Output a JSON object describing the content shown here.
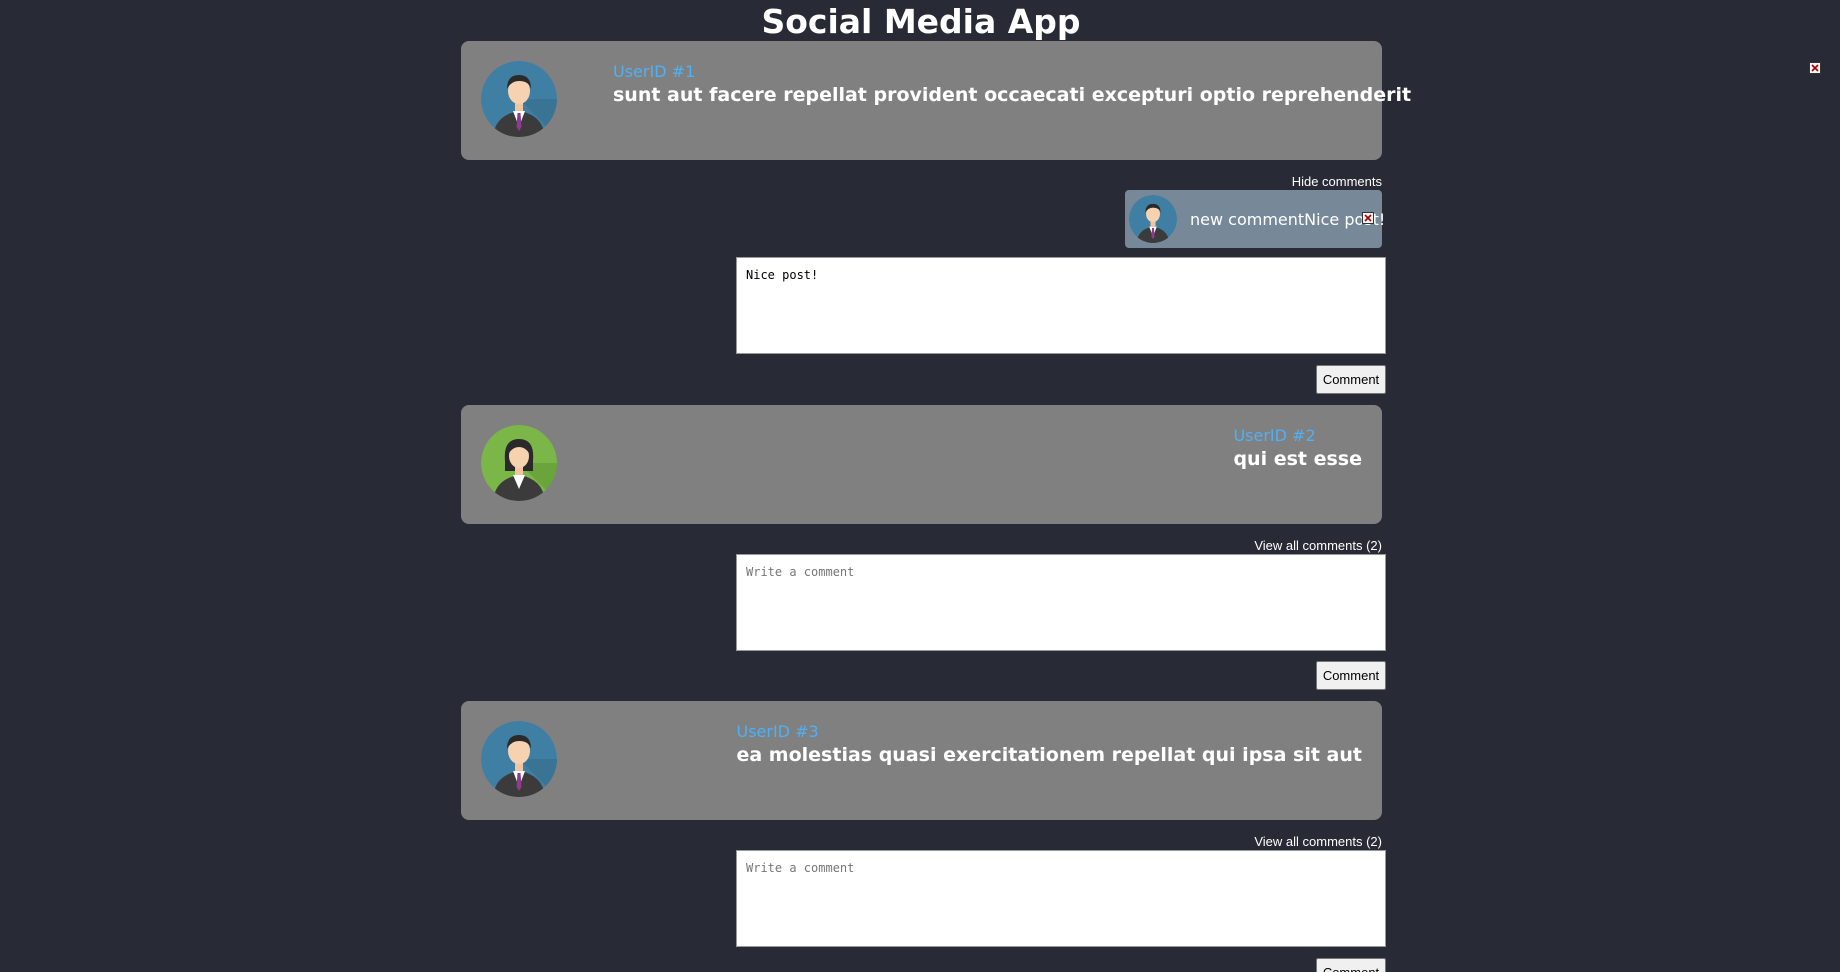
{
  "app": {
    "title": "Social Media App"
  },
  "posts": [
    {
      "user_label": "UserID #1",
      "title": "sunt aut facere repellat provident occaecati excepturi optio reprehenderit",
      "avatar": "male-avatar-icon",
      "comments_toggle": "Hide comments",
      "comments": [
        {
          "text": "new commentNice post!",
          "avatar": "male-avatar-icon"
        }
      ],
      "input_value": "Nice post!",
      "input_placeholder": "Write a comment",
      "button_label": "Comment"
    },
    {
      "user_label": "UserID #2",
      "title": "qui est esse",
      "avatar": "female-avatar-icon",
      "comments_toggle": "View all comments (2)",
      "comments": [],
      "input_value": "",
      "input_placeholder": "Write a comment",
      "button_label": "Comment"
    },
    {
      "user_label": "UserID #3",
      "title": "ea molestias quasi exercitationem repellat qui ipsa sit aut",
      "avatar": "male-avatar-icon",
      "comments_toggle": "View all comments (2)",
      "comments": [],
      "input_value": "",
      "input_placeholder": "Write a comment",
      "button_label": "Comment"
    }
  ],
  "colors": {
    "background": "#282a35",
    "card": "#808080",
    "user_id_link": "#4fb0f5",
    "comment_bubble": "#778899"
  }
}
